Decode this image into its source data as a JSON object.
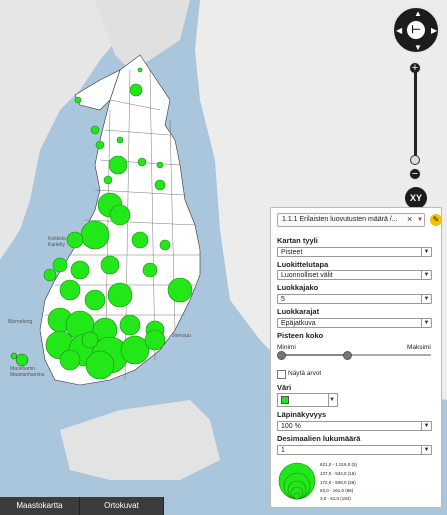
{
  "map": {
    "place_labels": [
      "Kokkola",
      "Karleby",
      "Joensuu",
      "Björneborg",
      "Mariehamn",
      "Maarianhamina"
    ],
    "base_color": "#ffffff",
    "sea_color": "#a9c6dd",
    "symbol_color": "#22e81a"
  },
  "controls": {
    "xy_label": "XY",
    "zoom_in": "+",
    "zoom_out": "−",
    "compass_icon": "compass-icon"
  },
  "panel": {
    "indicator_label": "1.1.1 Erilaisten luovutusten määrä /...",
    "style_label": "Kartan tyyli",
    "style_value": "Pisteet",
    "method_label": "Luokittelutapa",
    "method_value": "Luonnolliset välit",
    "classes_label": "Luokkajako",
    "classes_value": "5",
    "limits_label": "Luokkarajat",
    "limits_value": "Epäjatkuva",
    "size_label": "Pisteen koko",
    "min_label": "Minimi",
    "max_label": "Maksimi",
    "show_values_label": "Näytä arvot",
    "color_label": "Väri",
    "opacity_label": "Läpinäkyvyys",
    "opacity_value": "100 %",
    "decimals_label": "Desimaalien lukumäärä",
    "decimals_value": "1",
    "legend": [
      "621,0 - 1 016,0  (5)",
      "137,0 - 534,0  (16)",
      "172,0 - 508,0  (28)",
      "63,0 - 161,0  (66)",
      "3,0 - 61,0  (194)"
    ]
  },
  "tabs": [
    "Maastokartta",
    "Ortokuvat"
  ]
}
